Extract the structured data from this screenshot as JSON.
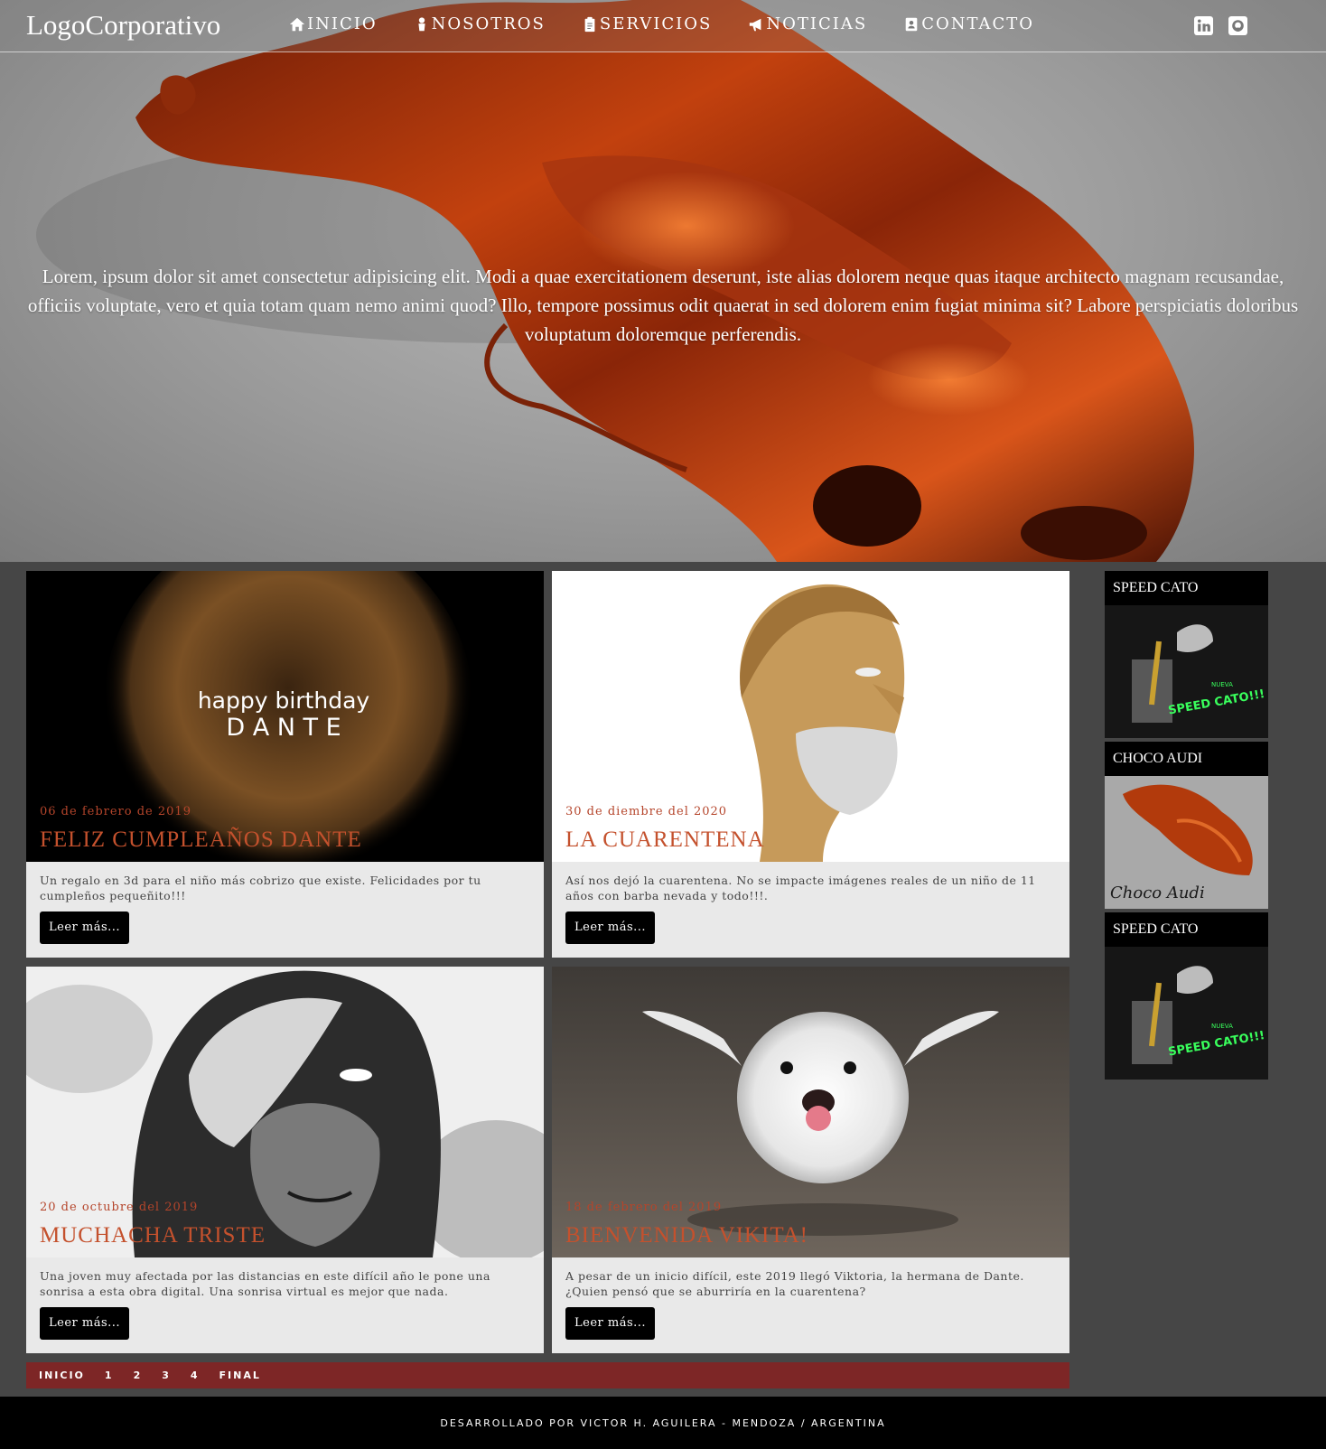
{
  "nav": {
    "logo": "LogoCorporativo",
    "items": [
      {
        "label": "INICIO",
        "icon": "home-icon"
      },
      {
        "label": "NOSOTROS",
        "icon": "user-icon"
      },
      {
        "label": "SERVICIOS",
        "icon": "clipboard-icon"
      },
      {
        "label": "NOTICIAS",
        "icon": "megaphone-icon"
      },
      {
        "label": "CONTACTO",
        "icon": "contact-card-icon"
      }
    ],
    "social": [
      "linkedin-icon",
      "github-icon"
    ]
  },
  "hero": {
    "text": "Lorem, ipsum dolor sit amet consectetur adipisicing elit. Modi a quae exercitationem deserunt, iste alias dolorem neque quas itaque architecto magnam recusandae, officiis voluptate, vero et quia totam quam nemo animi quod? Illo, tempore possimus odit quaerat in sed dolorem enim fugiat minima sit? Labore perspiciatis doloribus voluptatum doloremque perferendis."
  },
  "cards": [
    {
      "date": "06 de febrero de 2019",
      "title": "FELIZ CUMPLEAÑOS DANTE",
      "description": "Un regalo en 3d para el niño más cobrizo que existe. Felicidades por tu cumpleños pequeñito!!!",
      "button": "Leer más...",
      "image_caption_1": "happy birthday",
      "image_caption_2": "D A N T E"
    },
    {
      "date": "30 de diembre del 2020",
      "title": "LA CUARENTENA",
      "description": "Así nos dejó la cuarentena. No se impacte imágenes reales de un niño de 11 años con barba nevada y todo!!!.",
      "button": "Leer más..."
    },
    {
      "date": "20 de octubre del 2019",
      "title": "MUCHACHA TRISTE",
      "description": "Una joven muy afectada por las distancias en este difícil año le pone una sonrisa a esta obra digital. Una sonrisa virtual es mejor que nada.",
      "button": "Leer más..."
    },
    {
      "date": "18 de febrero del 2019",
      "title": "BIENVENIDA VIKITA!",
      "description": "A pesar de un inicio difícil, este 2019 llegó Viktoria, la hermana de Dante. ¿Quien pensó que se aburriría en la cuarentena?",
      "button": "Leer más..."
    }
  ],
  "sidebar": [
    {
      "title": "SPEED CATO",
      "badge_small": "NUEVA",
      "badge": "SPEED CATO!!!"
    },
    {
      "title": "CHOCO AUDI",
      "signature": "Choco Audi"
    },
    {
      "title": "SPEED CATO",
      "badge_small": "NUEVA",
      "badge": "SPEED CATO!!!"
    }
  ],
  "pagination": [
    "INICIO",
    "1",
    "2",
    "3",
    "4",
    "FINAL"
  ],
  "footer": "DESARROLLADO POR VICTOR H. AGUILERA - MENDOZA / ARGENTINA",
  "colors": {
    "accent": "#c4512d",
    "pager": "#7d2626",
    "background": "#464646"
  }
}
